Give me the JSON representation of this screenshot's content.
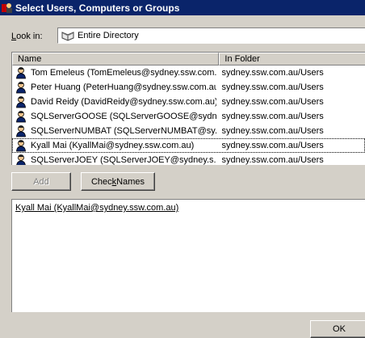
{
  "window": {
    "title": "Select Users, Computers or Groups",
    "icon": "users-icon"
  },
  "lookin": {
    "label_prefix": "",
    "label_accel": "L",
    "label_rest": "ook in:",
    "value": "Entire Directory",
    "icon": "directory-book-icon"
  },
  "list": {
    "columns": [
      "Name",
      "In Folder"
    ],
    "rows": [
      {
        "name": "Tom Emeleus (TomEmeleus@sydney.ssw.com....",
        "folder": "sydney.ssw.com.au/Users"
      },
      {
        "name": "Peter Huang (PeterHuang@sydney.ssw.com.au)",
        "folder": "sydney.ssw.com.au/Users"
      },
      {
        "name": "David Reidy (DavidReidy@sydney.ssw.com.au)",
        "folder": "sydney.ssw.com.au/Users"
      },
      {
        "name": "SQLServerGOOSE (SQLServerGOOSE@sydn...",
        "folder": "sydney.ssw.com.au/Users"
      },
      {
        "name": "SQLServerNUMBAT (SQLServerNUMBAT@sy...",
        "folder": "sydney.ssw.com.au/Users"
      },
      {
        "name": "Kyall Mai (KyallMai@sydney.ssw.com.au)",
        "folder": "sydney.ssw.com.au/Users"
      },
      {
        "name": "SQLServerJOEY (SQLServerJOEY@sydney.s...",
        "folder": "sydney.ssw.com.au/Users"
      }
    ]
  },
  "buttons": {
    "add": "Add",
    "check_names_pre": "Chec",
    "check_names_accel": "k",
    "check_names_post": " Names",
    "ok": "OK"
  },
  "selected_names": "Kyall Mai (KyallMai@sydney.ssw.com.au)",
  "colors": {
    "titlebar": "#0a246a",
    "face": "#d4d0c8"
  }
}
